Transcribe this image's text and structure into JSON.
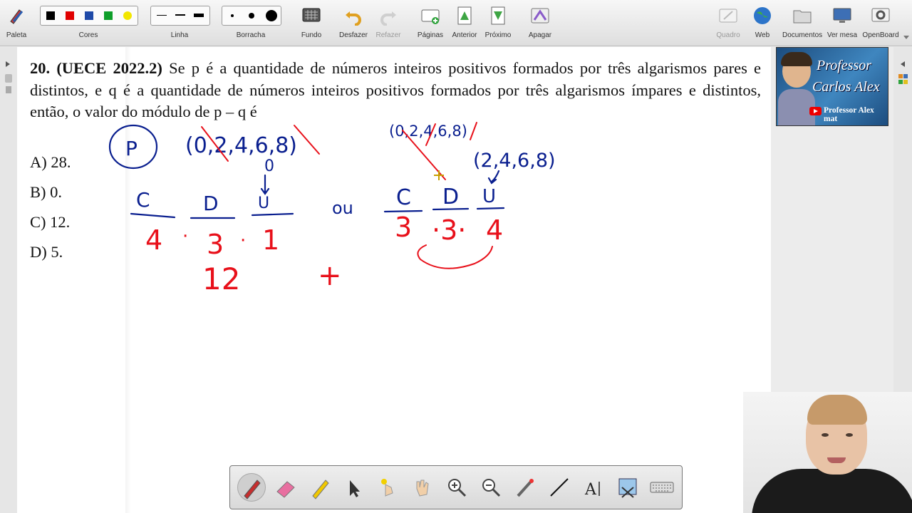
{
  "toolbar": {
    "paleta": "Paleta",
    "cores": "Cores",
    "linha": "Linha",
    "borracha": "Borracha",
    "fundo": "Fundo",
    "desfazer": "Desfazer",
    "refazer": "Refazer",
    "paginas": "Páginas",
    "anterior": "Anterior",
    "proximo": "Próximo",
    "apagar": "Apagar",
    "quadro": "Quadro",
    "web": "Web",
    "documentos": "Documentos",
    "ver_mesa": "Ver mesa",
    "openboard": "OpenBoard"
  },
  "colors": {
    "black": "#000000",
    "red": "#e00000",
    "blue": "#1f4aa8",
    "green": "#0e9e2a",
    "yellow": "#f2e600",
    "ink_blue": "#0a1f8f",
    "ink_red": "#e8101a"
  },
  "question": {
    "label": "20. (UECE 2022.2)",
    "body": " Se p é a quantidade de números inteiros positivos formados por três algarismos pares e distintos, e q é a quantidade de números inteiros positivos formados por três algarismos ímpares e distintos, então, o valor do módulo de p – q é",
    "options": [
      "A) 28.",
      "B) 0.",
      "C) 12.",
      "D) 5."
    ]
  },
  "ink": {
    "p_circle": "P",
    "set1": "(0,2,4,6,8)",
    "set2": "(0,2,4,6,8)",
    "set3": "(2,4,6,8)",
    "zero": "0",
    "c1": "C",
    "d1": "D",
    "u1": "U",
    "n1": "4",
    "dot1": "·",
    "n2": "3",
    "dot2": "·",
    "n3": "1",
    "ou": "ou",
    "c2": "C",
    "d2": "D",
    "u2": "U",
    "m1": "3",
    "m2": "·3·",
    "m3": "4",
    "result": "12",
    "plus": "+"
  },
  "logo": {
    "line1": "Professor",
    "line2": "Carlos Alex",
    "channel": "Professor Alex mat"
  },
  "icons": [
    "pen-icon",
    "eraser-icon",
    "highlighter-icon",
    "arrow-pointer-icon",
    "laser-icon",
    "hand-icon",
    "zoom-in-icon",
    "zoom-out-icon",
    "pointer-icon",
    "line-icon",
    "text-icon",
    "capture-icon",
    "keyboard-icon"
  ]
}
